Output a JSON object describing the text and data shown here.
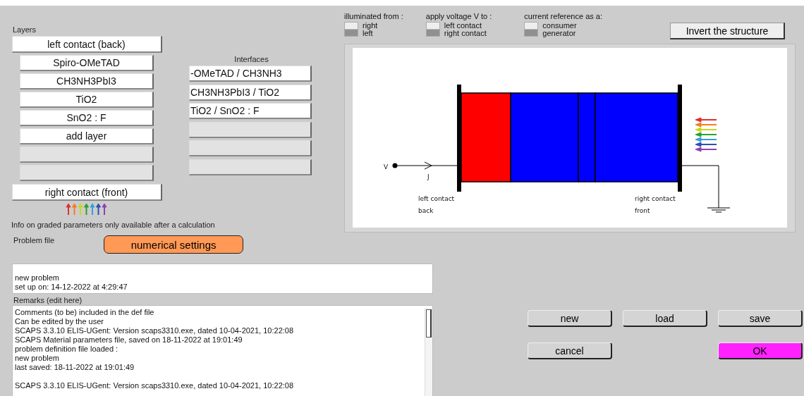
{
  "layers": {
    "title": "Layers",
    "left_contact": "left contact (back)",
    "right_contact": "right contact (front)",
    "items": [
      {
        "kind": "layer",
        "label": "Spiro-OMeTAD"
      },
      {
        "kind": "layer",
        "label": "CH3NH3PbI3"
      },
      {
        "kind": "layer",
        "label": "TiO2"
      },
      {
        "kind": "layer",
        "label": "SnO2 : F"
      },
      {
        "kind": "add",
        "label": "add layer"
      },
      {
        "kind": "empty"
      },
      {
        "kind": "empty"
      }
    ]
  },
  "interfaces": {
    "title": "Interfaces",
    "items": [
      {
        "kind": "interface",
        "label": "-OMeTAD / CH3NH3"
      },
      {
        "kind": "interface",
        "label": "CH3NH3PbI3 / TiO2"
      },
      {
        "kind": "interface",
        "label": "TiO2 / SnO2 : F"
      },
      {
        "kind": "empty"
      },
      {
        "kind": "empty"
      },
      {
        "kind": "empty"
      }
    ]
  },
  "info": "Info on graded parameters only available after a calculation",
  "toggles": [
    {
      "title": "illuminated from :",
      "options": [
        {
          "label": "right",
          "selected": true
        },
        {
          "label": "left",
          "selected": false
        }
      ]
    },
    {
      "title": "apply voltage V to :",
      "options": [
        {
          "label": "left contact",
          "selected": true
        },
        {
          "label": "right contact",
          "selected": false
        }
      ]
    },
    {
      "title": "current reference as a:",
      "options": [
        {
          "label": "consumer",
          "selected": true
        },
        {
          "label": "generator",
          "selected": false
        }
      ]
    }
  ],
  "invert_button": "Invert the structure",
  "device": {
    "voltage": "V",
    "current": "J",
    "left_contact": "left contact",
    "left_side": "back",
    "right_contact": "right contact",
    "right_side": "front"
  },
  "numerical_settings": "numerical settings",
  "problem_file": {
    "title": "Problem file",
    "lines": [
      "new problem",
      "set up on: 14-12-2022 at 4:29:47"
    ]
  },
  "remarks": {
    "title": "Remarks (edit here)",
    "lines": [
      {
        "kind": "text",
        "text": "Comments (to be) included in the def file"
      },
      {
        "kind": "text",
        "text": "Can be edited by the user"
      },
      {
        "kind": "text",
        "text": "SCAPS 3.3.10 ELIS-UGent: Version scaps3310.exe, dated 10-04-2021, 10:22:08"
      },
      {
        "kind": "text",
        "text": "SCAPS Material parameters file, saved on 18-11-2022 at 19:01:49"
      },
      {
        "kind": "text",
        "text": "problem definition file loaded :"
      },
      {
        "kind": "text",
        "text": "new problem"
      },
      {
        "kind": "text",
        "text": "last saved: 18-11-2022 at 19:01:49"
      },
      {
        "kind": "blank"
      },
      {
        "kind": "text",
        "text": "SCAPS 3.3.10 ELIS-UGent: Version scaps3310.exe, dated 10-04-2021, 10:22:08"
      }
    ]
  },
  "buttons": [
    {
      "kind": "plain",
      "label": "new"
    },
    {
      "kind": "plain",
      "label": "load"
    },
    {
      "kind": "plain",
      "label": "save"
    },
    {
      "kind": "plain",
      "label": "cancel"
    },
    {
      "kind": "gap"
    },
    {
      "kind": "ok",
      "label": "OK"
    }
  ]
}
